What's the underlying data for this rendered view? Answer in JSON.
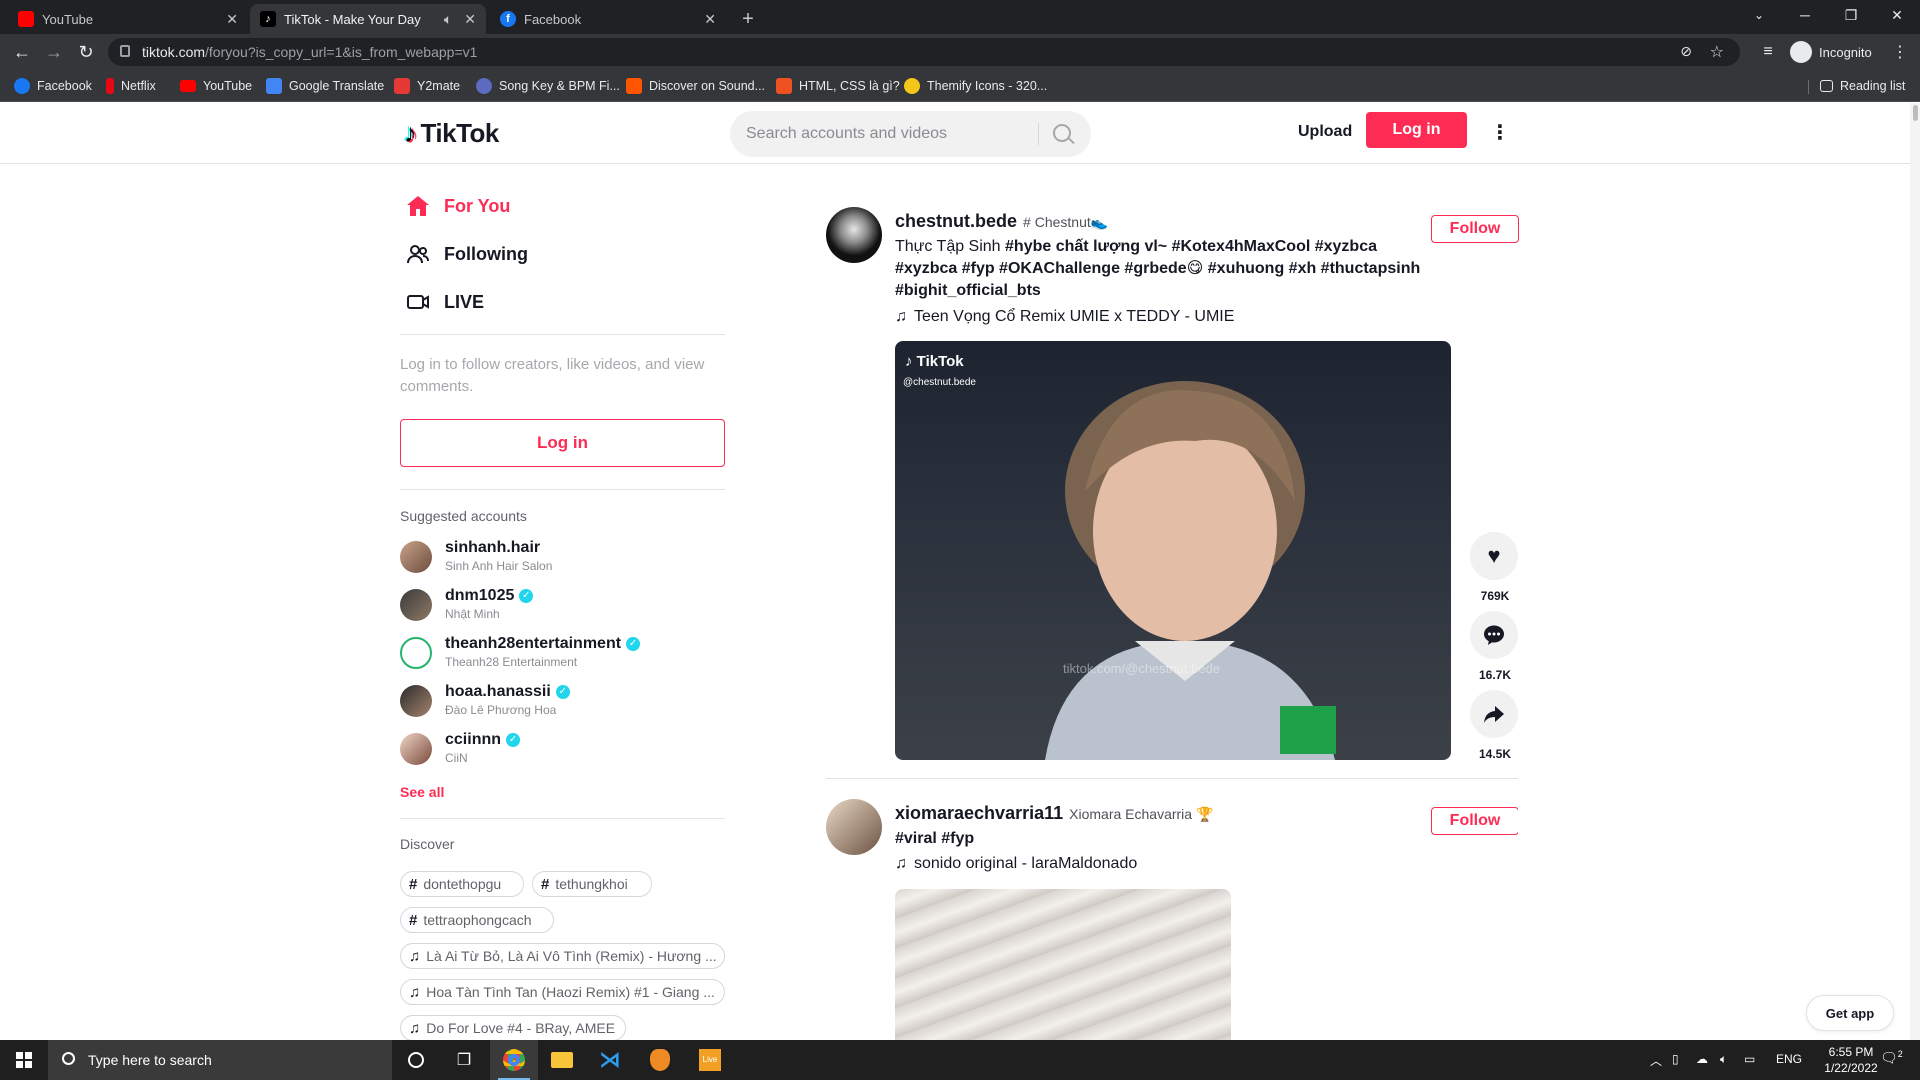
{
  "browser": {
    "tabs": [
      {
        "title": "YouTube",
        "favicon": "youtube-icon",
        "color": "#ff0000"
      },
      {
        "title": "TikTok - Make Your Day",
        "favicon": "tiktok-icon",
        "color": "#000000",
        "active": true
      },
      {
        "title": "Facebook",
        "favicon": "facebook-icon",
        "color": "#1877f2"
      }
    ],
    "new_tab": "+",
    "url_host": "tiktok.com",
    "url_rest": "/foryou?is_copy_url=1&is_from_webapp=v1",
    "profile_label": "Incognito",
    "bookmarks": [
      {
        "label": "Facebook",
        "icon": "facebook-icon",
        "color": "#1877f2"
      },
      {
        "label": "Netflix",
        "icon": "netflix-icon",
        "color": "#e50914"
      },
      {
        "label": "YouTube",
        "icon": "youtube-icon",
        "color": "#ff0000"
      },
      {
        "label": "Google Translate",
        "icon": "google-translate-icon",
        "color": "#4285f4"
      },
      {
        "label": "Y2mate",
        "icon": "y2mate-icon",
        "color": "#e53935"
      },
      {
        "label": "Song Key & BPM Fi...",
        "icon": "song-key-icon",
        "color": "#5c6bc0"
      },
      {
        "label": "Discover on Sound...",
        "icon": "soundcloud-icon",
        "color": "#ff5500"
      },
      {
        "label": "HTML, CSS là gì?",
        "icon": "f8-icon",
        "color": "#f05123"
      },
      {
        "label": "Themify Icons - 320...",
        "icon": "themify-icon",
        "color": "#f5c518"
      }
    ],
    "reading_list": "Reading list"
  },
  "tiktok": {
    "logo": "TikTok",
    "search_placeholder": "Search accounts and videos",
    "upload": "Upload",
    "login": "Log in",
    "brand_color": "#fe2c55",
    "nav": [
      {
        "label": "For You",
        "icon": "home-icon",
        "active": true
      },
      {
        "label": "Following",
        "icon": "following-icon"
      },
      {
        "label": "LIVE",
        "icon": "live-icon"
      }
    ],
    "login_prompt": "Log in to follow creators, like videos, and view comments.",
    "sidebar_login": "Log in",
    "suggested_title": "Suggested accounts",
    "suggested": [
      {
        "username": "sinhanh.hair",
        "name": "Sinh Anh Hair Salon",
        "verified": false
      },
      {
        "username": "dnm1025",
        "name": "Nhật Minh",
        "verified": true
      },
      {
        "username": "theanh28entertainment",
        "name": "Theanh28 Entertainment",
        "verified": true
      },
      {
        "username": "hoaa.hanassii",
        "name": "Đào Lê Phương Hoa",
        "verified": true
      },
      {
        "username": "cciinnn",
        "name": "CiiN",
        "verified": true
      }
    ],
    "see_all": "See all",
    "discover_title": "Discover",
    "discover": [
      {
        "type": "hashtag",
        "label": "dontethopgu"
      },
      {
        "type": "hashtag",
        "label": "tethungkhoi"
      },
      {
        "type": "hashtag",
        "label": "tettraophongcach"
      },
      {
        "type": "music",
        "label": "Là Ai Từ Bỏ, Là Ai Vô Tình (Remix) - Hương ..."
      },
      {
        "type": "music",
        "label": "Hoa Tàn Tình Tan (Haozi Remix) #1 - Giang ..."
      },
      {
        "type": "music",
        "label": "Do For Love #4 - BRay, AMEE"
      }
    ],
    "posts": [
      {
        "username": "chestnut.bede",
        "nickname": "# Chestnut👟",
        "caption_plain": "Thực Tập Sinh ",
        "caption_tags": "#hybe chất lượng vl~ #Kotex4hMaxCool #xyzbca #xyzbca #fyp #OKAChallenge #grbede😋 #xuhuong #xh #thuctapsinh #bighit_official_bts",
        "music": "Teen Vọng Cổ Remix UMIE x TEDDY - UMIE",
        "follow": "Follow",
        "watermark": "TikTok",
        "watermark_user": "@chestnut.bede",
        "video_overlay": "tiktok.com/@chestnut.bede",
        "likes": "769K",
        "comments": "16.7K",
        "shares": "14.5K"
      },
      {
        "username": "xiomaraechvarria11",
        "nickname": "Xiomara Echavarria 🏆",
        "caption_tags": "#viral #fyp",
        "music": "sonido original - laraMaldonado",
        "follow": "Follow"
      }
    ],
    "get_app": "Get app"
  },
  "taskbar": {
    "search_placeholder": "Type here to search",
    "language": "ENG",
    "time": "6:55 PM",
    "date": "1/22/2022",
    "notification_count": "2"
  }
}
